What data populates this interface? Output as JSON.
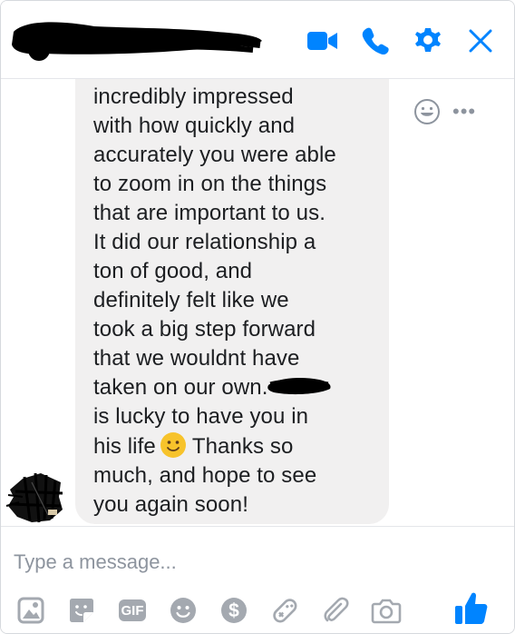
{
  "header": {
    "contact_name": "",
    "icons": [
      "video-call-icon",
      "phone-call-icon",
      "settings-icon",
      "close-icon"
    ]
  },
  "message": {
    "lines": [
      "incredibly impressed",
      "with how quickly and",
      "accurately you were able",
      "to zoom in on the things",
      "that are important to us.",
      "It did our relationship a",
      "ton of good, and",
      "definitely felt like we",
      "took a big step forward",
      "that we wouldnt have",
      "taken on our own.",
      "is lucky to have you in",
      "his life",
      "Thanks so",
      "much, and hope to see",
      "you again soon!"
    ],
    "more_label": "•••"
  },
  "composer": {
    "placeholder": "Type a message...",
    "gif_label": "GIF",
    "tools": [
      "photo-icon",
      "sticker-icon",
      "gif-icon",
      "emoji-icon",
      "payment-icon",
      "game-icon",
      "attachment-icon",
      "camera-icon",
      "like-icon"
    ]
  },
  "colors": {
    "accent": "#0084ff",
    "bubble": "#f1f0f0",
    "toolbar_icon": "#a4a9b0",
    "text": "#1c1e21"
  }
}
